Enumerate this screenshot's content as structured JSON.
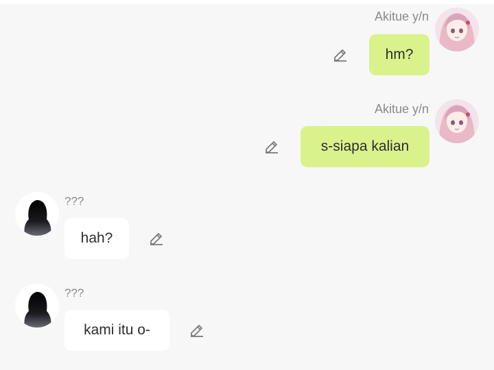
{
  "messages": [
    {
      "direction": "outgoing",
      "sender": "Akitue y/n",
      "text": "hm?",
      "avatar_icon": "anime-girl-avatar-icon",
      "edit_icon": "pencil-icon"
    },
    {
      "direction": "outgoing",
      "sender": "Akitue y/n",
      "text": "s-siapa kalian",
      "avatar_icon": "anime-girl-avatar-icon",
      "edit_icon": "pencil-icon"
    },
    {
      "direction": "incoming",
      "sender": "???",
      "text": "hah?",
      "avatar_icon": "silhouette-avatar-icon",
      "edit_icon": "pencil-icon"
    },
    {
      "direction": "incoming",
      "sender": "???",
      "text": "kami itu o-",
      "avatar_icon": "silhouette-avatar-icon",
      "edit_icon": "pencil-icon"
    }
  ],
  "colors": {
    "background": "#f7f7f7",
    "outgoing_bubble": "#d9f28c",
    "incoming_bubble": "#ffffff",
    "name_text": "#8a8a8a",
    "message_text": "#2d2d2d",
    "edit_icon": "#777777"
  }
}
